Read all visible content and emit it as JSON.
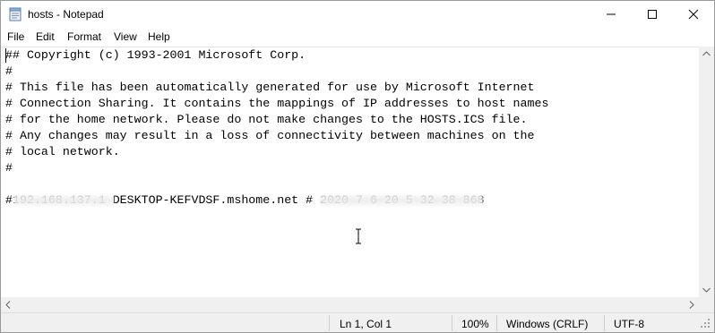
{
  "window": {
    "title": "hosts - Notepad",
    "controls": [
      "minimize-icon",
      "maximize-icon",
      "close-icon"
    ]
  },
  "menu": [
    "File",
    "Edit",
    "Format",
    "View",
    "Help"
  ],
  "editor": {
    "lines": [
      "## Copyright (c) 1993-2001 Microsoft Corp.",
      "#",
      "# This file has been automatically generated for use by Microsoft Internet",
      "# Connection Sharing. It contains the mappings of IP addresses to host names",
      "# for the home network. Please do not make changes to the HOSTS.ICS file.",
      "# Any changes may result in a loss of connectivity between machines on the",
      "# local network.",
      "#",
      "",
      "#192.168.137.1 DESKTOP-KEFVDSF.mshome.net # 2020 7 6 20 5 32 38 868"
    ]
  },
  "statusbar": {
    "position": "Ln 1, Col 1",
    "zoom": "100%",
    "line_ending": "Windows (CRLF)",
    "encoding": "UTF-8"
  }
}
